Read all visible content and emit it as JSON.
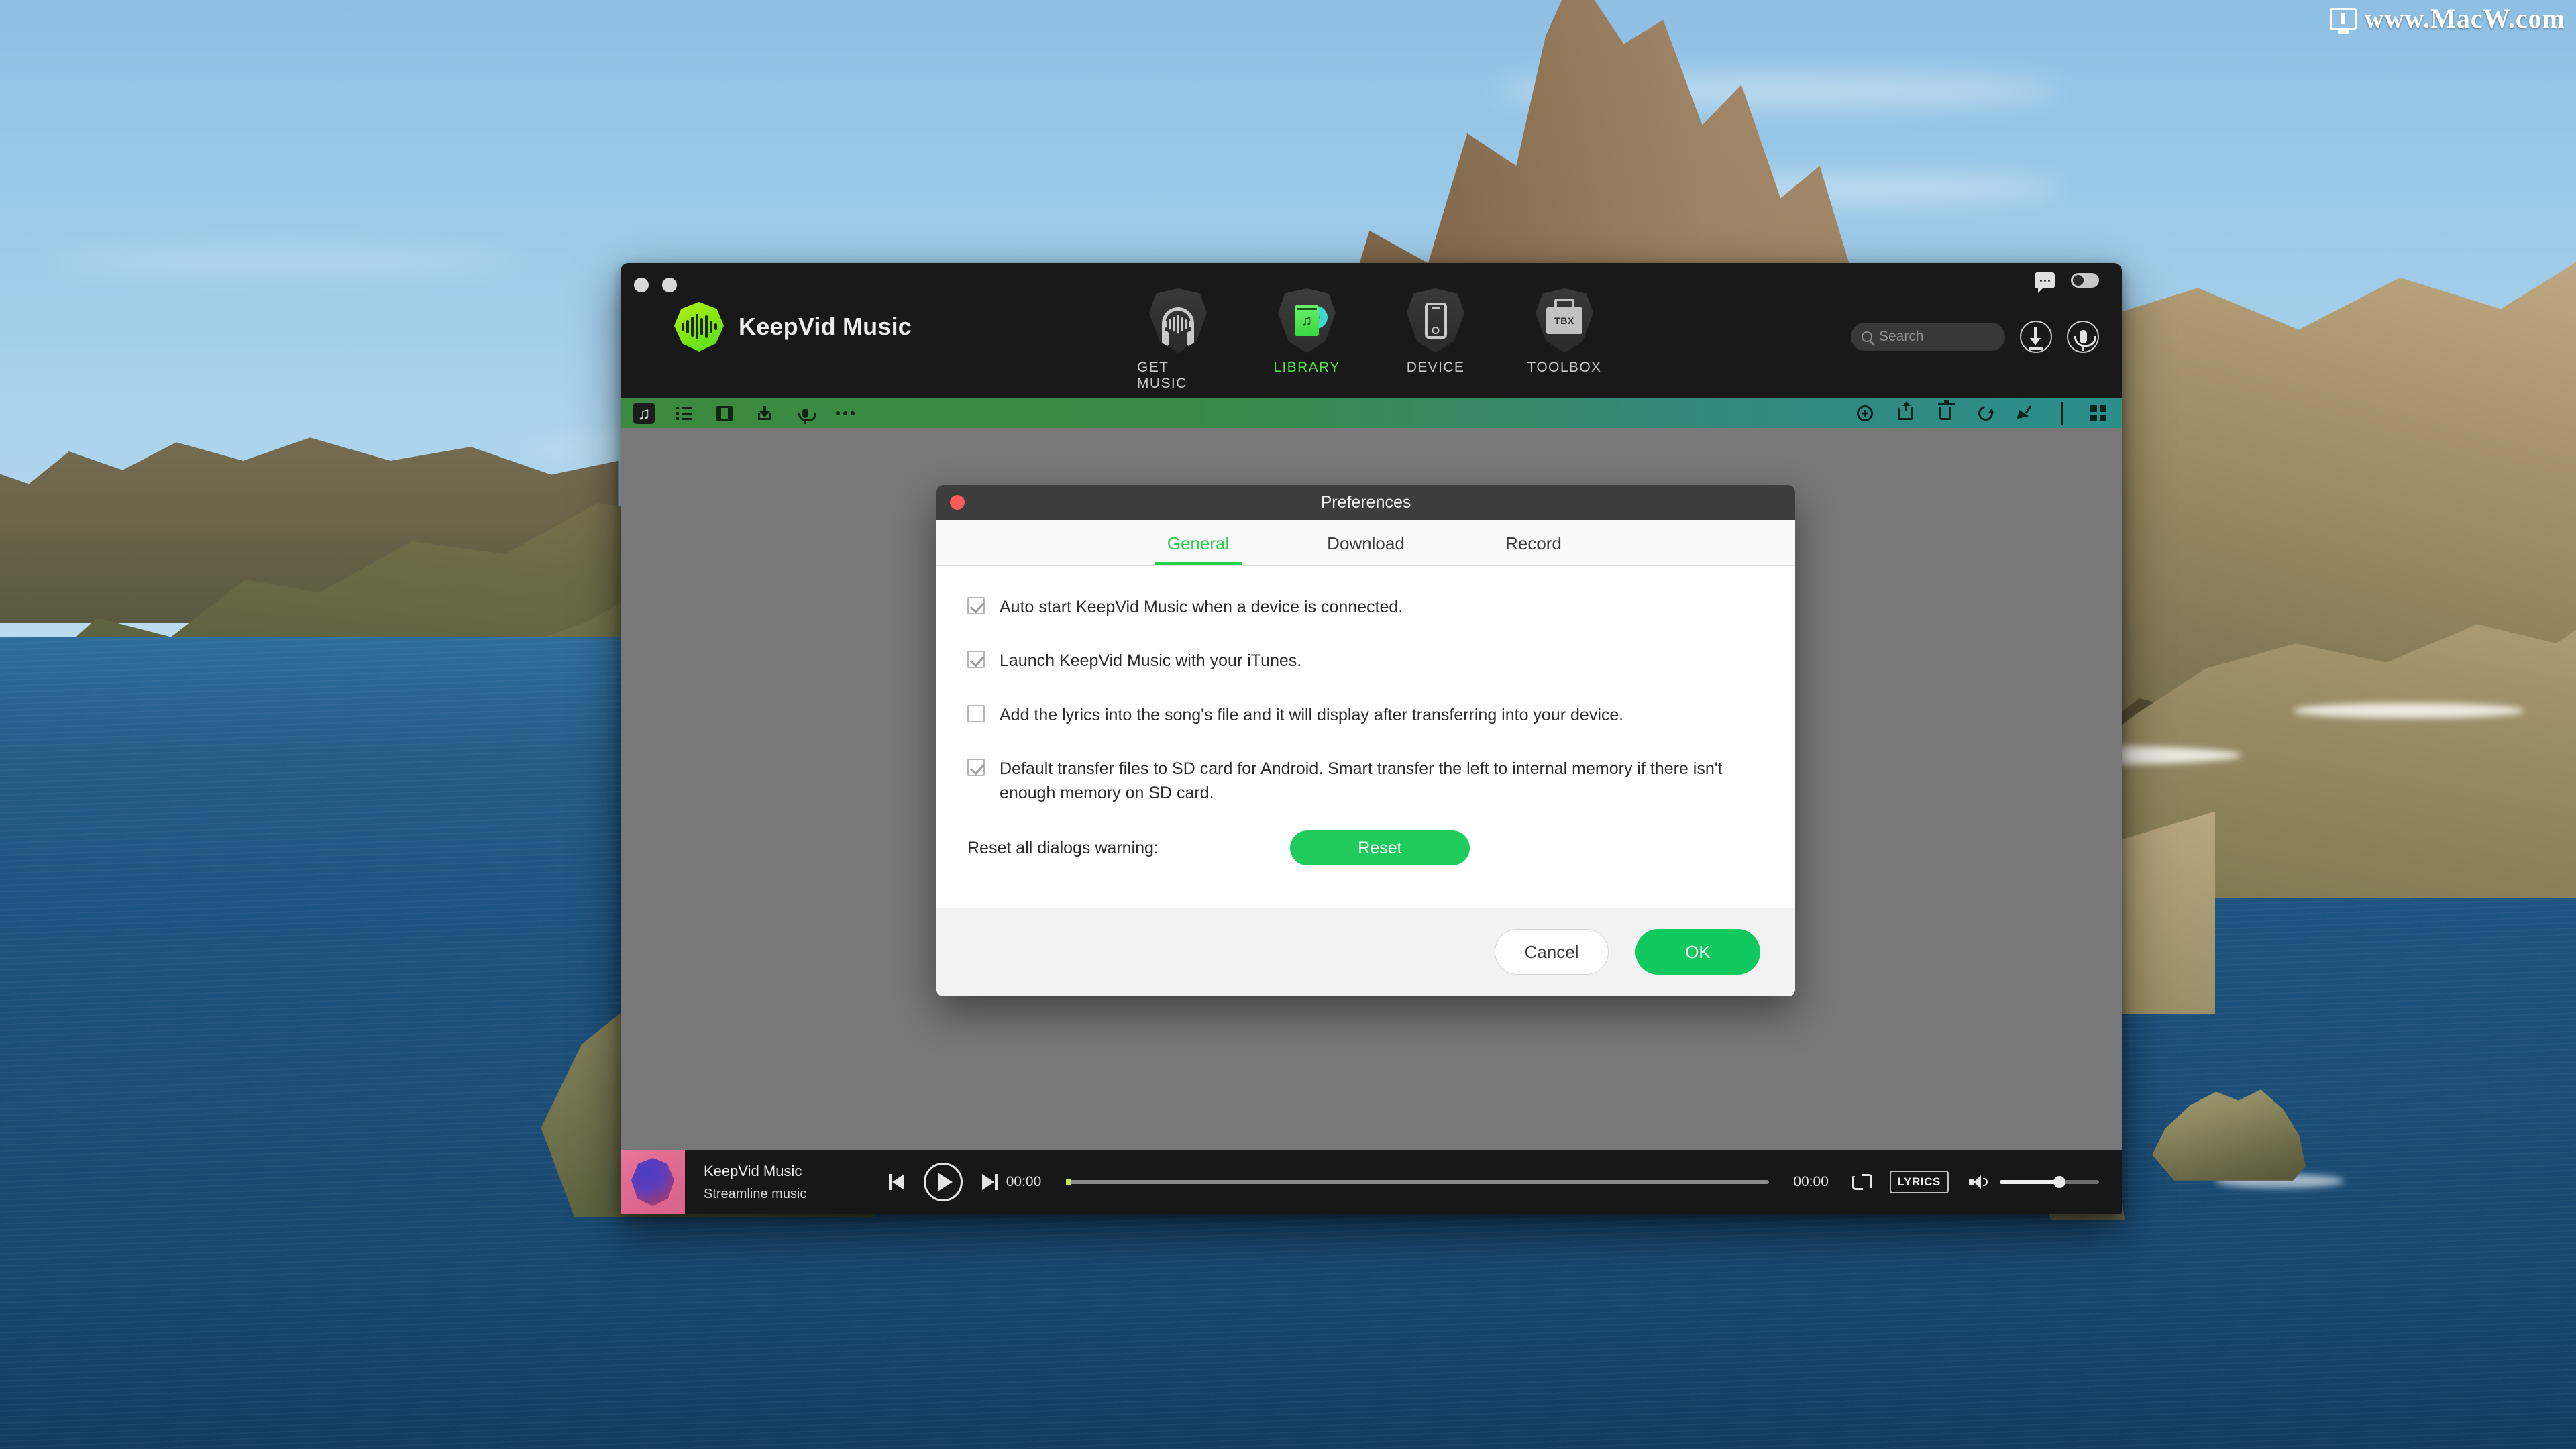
{
  "watermark": {
    "text": "www.MacW.com",
    "icon": "monitor-icon"
  },
  "app": {
    "brand": "KeepVid Music",
    "nav": [
      {
        "label": "GET MUSIC",
        "icon": "headphones-icon",
        "active": false
      },
      {
        "label": "LIBRARY",
        "icon": "library-icon",
        "active": true
      },
      {
        "label": "DEVICE",
        "icon": "phone-icon",
        "active": false
      },
      {
        "label": "TOOLBOX",
        "icon": "toolbox-icon",
        "badge": "TBX",
        "active": false
      }
    ],
    "header_right": {
      "chat_icon": "chat-icon",
      "toggle_icon": "toggle-switch",
      "download_icon": "download-icon",
      "mic_icon": "microphone-icon"
    },
    "search": {
      "placeholder": "Search",
      "value": ""
    },
    "toolbar_left": [
      {
        "icon": "music-note-icon",
        "active": true
      },
      {
        "icon": "list-icon",
        "active": false
      },
      {
        "icon": "film-icon",
        "active": false
      },
      {
        "icon": "download-icon",
        "active": false
      },
      {
        "icon": "microphone-icon",
        "active": false
      },
      {
        "icon": "more-dots-icon",
        "active": false
      }
    ],
    "toolbar_right": [
      {
        "icon": "add-circle-icon"
      },
      {
        "icon": "share-icon"
      },
      {
        "icon": "trash-icon"
      },
      {
        "icon": "refresh-icon"
      },
      {
        "icon": "broom-icon"
      },
      {
        "icon": "grid-view-icon"
      }
    ],
    "colors": {
      "toolbar_start": "#3b8a3f",
      "toolbar_end": "#2a8f8a",
      "accent_green": "#24d14a",
      "titlebar": "#191919",
      "content": "#787878"
    }
  },
  "player": {
    "track_title": "KeepVid Music",
    "track_subtitle": "Streamline music",
    "elapsed": "00:00",
    "duration": "00:00",
    "lyrics_label": "LYRICS",
    "seek_percent": 0,
    "volume_percent": 60,
    "prev_icon": "previous-track-icon",
    "play_icon": "play-icon",
    "next_icon": "next-track-icon",
    "repeat_icon": "repeat-icon",
    "volume_icon": "volume-icon"
  },
  "prefs": {
    "title": "Preferences",
    "close_icon": "close-icon",
    "tabs": [
      {
        "label": "General",
        "active": true
      },
      {
        "label": "Download",
        "active": false
      },
      {
        "label": "Record",
        "active": false
      }
    ],
    "options": [
      {
        "label": "Auto start KeepVid Music when a device is  connected.",
        "checked": true
      },
      {
        "label": "Launch KeepVid Music with your iTunes.",
        "checked": true
      },
      {
        "label": "Add the lyrics into the song's file and it will display after transferring into your device.",
        "checked": false
      },
      {
        "label": "Default transfer files to SD card for Android. Smart transfer the left to internal memory if there isn't enough memory on SD card.",
        "checked": true
      }
    ],
    "reset_label": "Reset all dialogs warning:",
    "reset_button": "Reset",
    "cancel_button": "Cancel",
    "ok_button": "OK"
  }
}
